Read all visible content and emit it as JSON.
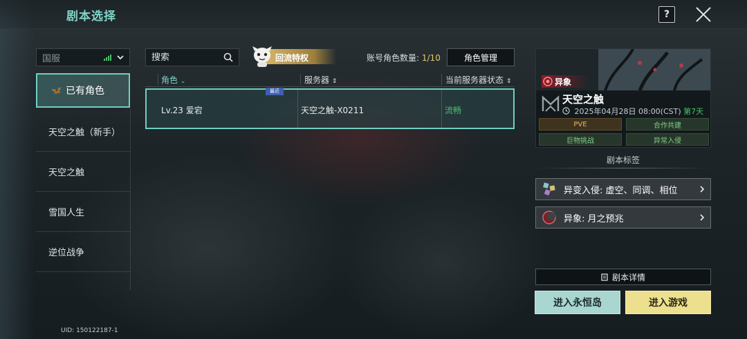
{
  "header": {
    "title": "剧本选择",
    "help_label": "?"
  },
  "left": {
    "region": {
      "label": "国服",
      "signal_color": "#4ac06c"
    },
    "owned_label": "已有角色",
    "scripts": [
      "天空之触（新手）",
      "天空之触",
      "雪国人生",
      "逆位战争"
    ],
    "uid": "UID: 150122187-1"
  },
  "toolbar": {
    "search_placeholder": "搜索",
    "return_privilege": "回流特权",
    "account_count_label": "账号角色数量:",
    "account_count_value": "1/10",
    "role_management": "角色管理"
  },
  "table": {
    "columns": [
      "角色",
      "服务器",
      "当前服务器状态"
    ],
    "rows": [
      {
        "character": "Lv.23 爱宕",
        "server": "天空之触-X0211",
        "status": "流畅",
        "badge": "最近"
      }
    ]
  },
  "script_card": {
    "badge": "异象",
    "title": "天空之触",
    "date": "2025年04月28日 08:00(CST)",
    "day": "第7天",
    "tags": [
      "PVE",
      "合作共建",
      "巨物挑战",
      "异常入侵"
    ]
  },
  "script_tags": {
    "heading": "剧本标签",
    "items": [
      {
        "label": "异变入侵: 虚空、同调、相位",
        "icon": "cubes-icon"
      },
      {
        "label": "异象: 月之预兆",
        "icon": "moon-omen-icon"
      }
    ]
  },
  "actions": {
    "details": "剧本详情",
    "enter_eternal_island": "进入永恒岛",
    "enter_game": "进入游戏"
  },
  "colors": {
    "accent": "#6fd0c2",
    "status_ok": "#4ac06c",
    "gold": "#e7c86b",
    "enter_game_bg": "#ece08f",
    "eternal_bg": "#a9d6d0"
  }
}
